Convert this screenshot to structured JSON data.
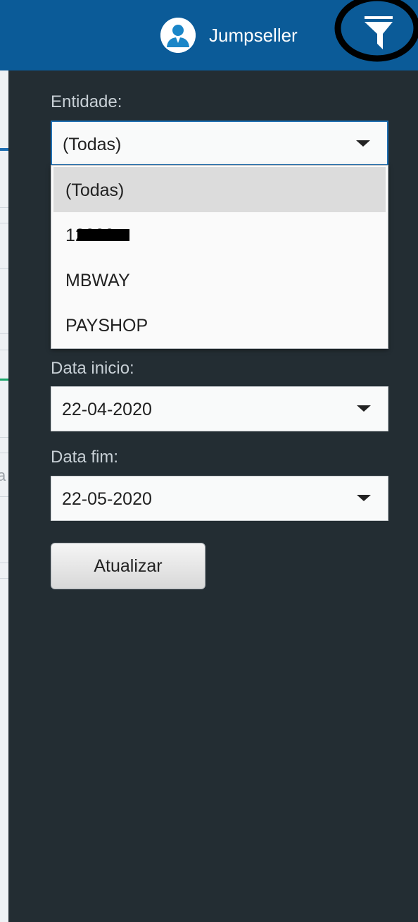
{
  "header": {
    "user_name": "Jumpseller",
    "user_icon": "user-avatar-icon",
    "filter_icon": "funnel-icon"
  },
  "colors": {
    "header_bg": "#0b5b98",
    "panel_bg": "#232d33",
    "accent_blue": "#1f6fb2"
  },
  "filters": {
    "entity": {
      "label": "Entidade:",
      "value": "(Todas)",
      "options": [
        {
          "label": "(Todas)",
          "selected": true
        },
        {
          "label": "12000",
          "selected": false,
          "redacted": true
        },
        {
          "label": "MBWAY",
          "selected": false
        },
        {
          "label": "PAYSHOP",
          "selected": false
        }
      ]
    },
    "start_date": {
      "label": "Data inicio:",
      "value": "22-04-2020"
    },
    "end_date": {
      "label": "Data fim:",
      "value": "22-05-2020"
    },
    "update_label": "Atualizar"
  },
  "background_strip": {
    "glyph": "a"
  }
}
